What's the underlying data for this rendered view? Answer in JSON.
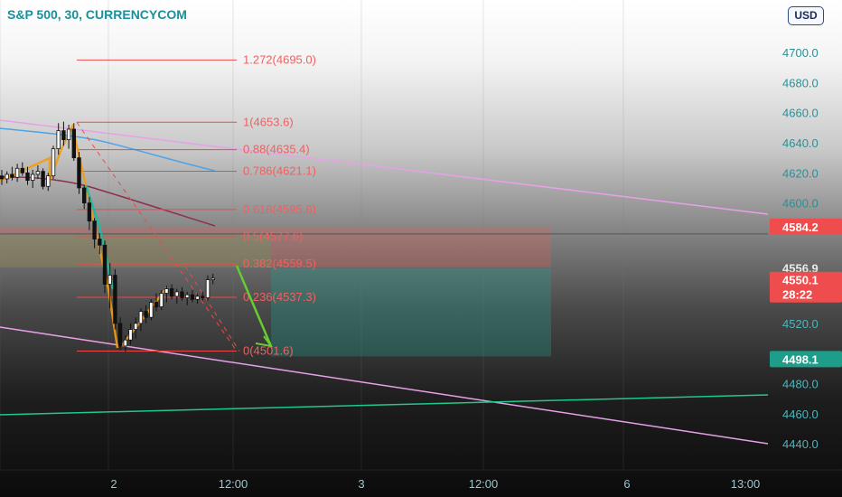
{
  "header": {
    "title": "S&P 500, 30, CURRENCYCOM",
    "currency": "USD"
  },
  "colors": {
    "up": "#ffffff",
    "down": "#111111",
    "wick": "#111111",
    "fib": "#f04848",
    "trend_pink": "#e8a0e8",
    "ma_blue": "#4ea3e6",
    "ma_maroon": "#8e2e4e",
    "green_line": "#1fc98a",
    "teal_tag": "#1e9e8a",
    "red_tag": "#ef4d4d",
    "orange_swing": "#f39c12",
    "green_swing": "#66cc33",
    "teal_swing": "#1abc9c"
  },
  "chart_data": {
    "type": "candlestick",
    "title": "S&P 500, 30, CURRENCYCOM",
    "ylim": [
      4430,
      4730
    ],
    "y_ticks": [
      "4700.0",
      "4680.0",
      "4660.0",
      "4640.0",
      "4620.0",
      "4600.0",
      "4520.0",
      "4480.0",
      "4460.0",
      "4440.0"
    ],
    "x_ticks": [
      "2",
      "12:00",
      "3",
      "12:00",
      "6",
      "13:00"
    ],
    "price_tags": [
      {
        "label": "4584.2",
        "kind": "red"
      },
      {
        "label": "4556.9",
        "kind": "gray"
      },
      {
        "label": "4550.1",
        "sub": "28:22",
        "kind": "red"
      },
      {
        "label": "4498.1",
        "kind": "teal"
      }
    ],
    "fib_levels": [
      {
        "ratio": "1.272",
        "price": 4695.0,
        "label": "1.272(4695.0)"
      },
      {
        "ratio": "1",
        "price": 4653.6,
        "label": "1(4653.6)"
      },
      {
        "ratio": "0.88",
        "price": 4635.4,
        "label": "0.88(4635.4)"
      },
      {
        "ratio": "0.786",
        "price": 4621.1,
        "label": "0.786(4621.1)"
      },
      {
        "ratio": "0.618",
        "price": 4595.6,
        "label": "0.618(4595.6)"
      },
      {
        "ratio": "0.5",
        "price": 4577.6,
        "label": "0.5(4577.6)"
      },
      {
        "ratio": "0.382",
        "price": 4559.5,
        "label": "0.382(4559.5)"
      },
      {
        "ratio": "0.236",
        "price": 4537.3,
        "label": "0.236(4537.3)"
      },
      {
        "ratio": "0",
        "price": 4501.6,
        "label": "0(4501.6)"
      }
    ],
    "position_box": {
      "entry": 4556.9,
      "stop": 4584.2,
      "target": 4498.1
    },
    "candles": [
      {
        "o": 4618,
        "h": 4622,
        "l": 4612,
        "c": 4616
      },
      {
        "o": 4616,
        "h": 4621,
        "l": 4613,
        "c": 4619
      },
      {
        "o": 4619,
        "h": 4624,
        "l": 4615,
        "c": 4617
      },
      {
        "o": 4617,
        "h": 4626,
        "l": 4614,
        "c": 4623
      },
      {
        "o": 4623,
        "h": 4627,
        "l": 4618,
        "c": 4620
      },
      {
        "o": 4620,
        "h": 4624,
        "l": 4612,
        "c": 4615
      },
      {
        "o": 4615,
        "h": 4622,
        "l": 4610,
        "c": 4619
      },
      {
        "o": 4619,
        "h": 4625,
        "l": 4616,
        "c": 4621
      },
      {
        "o": 4621,
        "h": 4623,
        "l": 4609,
        "c": 4611
      },
      {
        "o": 4611,
        "h": 4620,
        "l": 4608,
        "c": 4618
      },
      {
        "o": 4618,
        "h": 4638,
        "l": 4616,
        "c": 4636
      },
      {
        "o": 4636,
        "h": 4653,
        "l": 4632,
        "c": 4648
      },
      {
        "o": 4648,
        "h": 4654,
        "l": 4638,
        "c": 4642
      },
      {
        "o": 4642,
        "h": 4652,
        "l": 4636,
        "c": 4649
      },
      {
        "o": 4649,
        "h": 4653,
        "l": 4628,
        "c": 4630
      },
      {
        "o": 4630,
        "h": 4634,
        "l": 4606,
        "c": 4610
      },
      {
        "o": 4610,
        "h": 4612,
        "l": 4596,
        "c": 4600
      },
      {
        "o": 4600,
        "h": 4604,
        "l": 4582,
        "c": 4588
      },
      {
        "o": 4588,
        "h": 4590,
        "l": 4570,
        "c": 4576
      },
      {
        "o": 4576,
        "h": 4580,
        "l": 4566,
        "c": 4572
      },
      {
        "o": 4572,
        "h": 4575,
        "l": 4540,
        "c": 4546
      },
      {
        "o": 4546,
        "h": 4560,
        "l": 4530,
        "c": 4552
      },
      {
        "o": 4552,
        "h": 4556,
        "l": 4516,
        "c": 4520
      },
      {
        "o": 4520,
        "h": 4524,
        "l": 4502,
        "c": 4505
      },
      {
        "o": 4505,
        "h": 4512,
        "l": 4501,
        "c": 4509
      },
      {
        "o": 4509,
        "h": 4520,
        "l": 4506,
        "c": 4516
      },
      {
        "o": 4516,
        "h": 4524,
        "l": 4510,
        "c": 4520
      },
      {
        "o": 4520,
        "h": 4530,
        "l": 4515,
        "c": 4528
      },
      {
        "o": 4528,
        "h": 4532,
        "l": 4520,
        "c": 4524
      },
      {
        "o": 4524,
        "h": 4536,
        "l": 4522,
        "c": 4534
      },
      {
        "o": 4534,
        "h": 4540,
        "l": 4528,
        "c": 4531
      },
      {
        "o": 4531,
        "h": 4542,
        "l": 4529,
        "c": 4540
      },
      {
        "o": 4540,
        "h": 4545,
        "l": 4534,
        "c": 4543
      },
      {
        "o": 4543,
        "h": 4546,
        "l": 4536,
        "c": 4538
      },
      {
        "o": 4538,
        "h": 4543,
        "l": 4533,
        "c": 4541
      },
      {
        "o": 4541,
        "h": 4544,
        "l": 4535,
        "c": 4537
      },
      {
        "o": 4537,
        "h": 4541,
        "l": 4532,
        "c": 4539
      },
      {
        "o": 4539,
        "h": 4542,
        "l": 4534,
        "c": 4536
      },
      {
        "o": 4536,
        "h": 4540,
        "l": 4533,
        "c": 4538
      },
      {
        "o": 4538,
        "h": 4541,
        "l": 4535,
        "c": 4537
      },
      {
        "o": 4537,
        "h": 4552,
        "l": 4535,
        "c": 4549
      },
      {
        "o": 4549,
        "h": 4553,
        "l": 4546,
        "c": 4550
      }
    ]
  }
}
